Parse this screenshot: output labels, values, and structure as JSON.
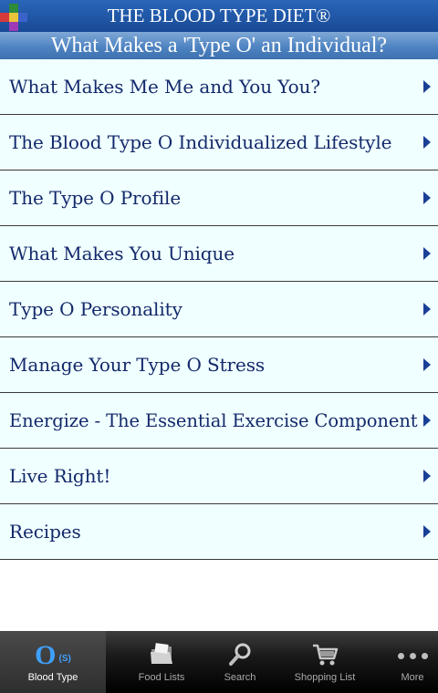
{
  "header": {
    "title": "THE BLOOD TYPE DIET®"
  },
  "subheader": {
    "title": "What Makes a 'Type O' an Individual?"
  },
  "menu": [
    {
      "label": "What Makes Me Me and You You?"
    },
    {
      "label": "The Blood Type O Individualized Lifestyle"
    },
    {
      "label": "The Type O Profile"
    },
    {
      "label": "What Makes You Unique"
    },
    {
      "label": "Type O Personality"
    },
    {
      "label": "Manage Your Type O Stress"
    },
    {
      "label": "Energize - The Essential Exercise Component"
    },
    {
      "label": "Live Right!"
    },
    {
      "label": "Recipes"
    }
  ],
  "tabs": {
    "blood_type": {
      "label": "Blood Type",
      "value": "O",
      "secretor": "(S)",
      "icon": "blood-type-icon"
    },
    "food_lists": {
      "label": "Food Lists",
      "icon": "folder-icon"
    },
    "search": {
      "label": "Search",
      "icon": "magnifier-icon"
    },
    "shopping_list": {
      "label": "Shopping List",
      "icon": "cart-icon"
    },
    "more": {
      "label": "More",
      "icon": "more-dots-icon"
    }
  },
  "colors": {
    "header": "#1f56a6",
    "item_bg": "#f0ffff",
    "item_text": "#13296b",
    "arrow": "#1a3f96",
    "tab_accent": "#3fa0ff"
  }
}
